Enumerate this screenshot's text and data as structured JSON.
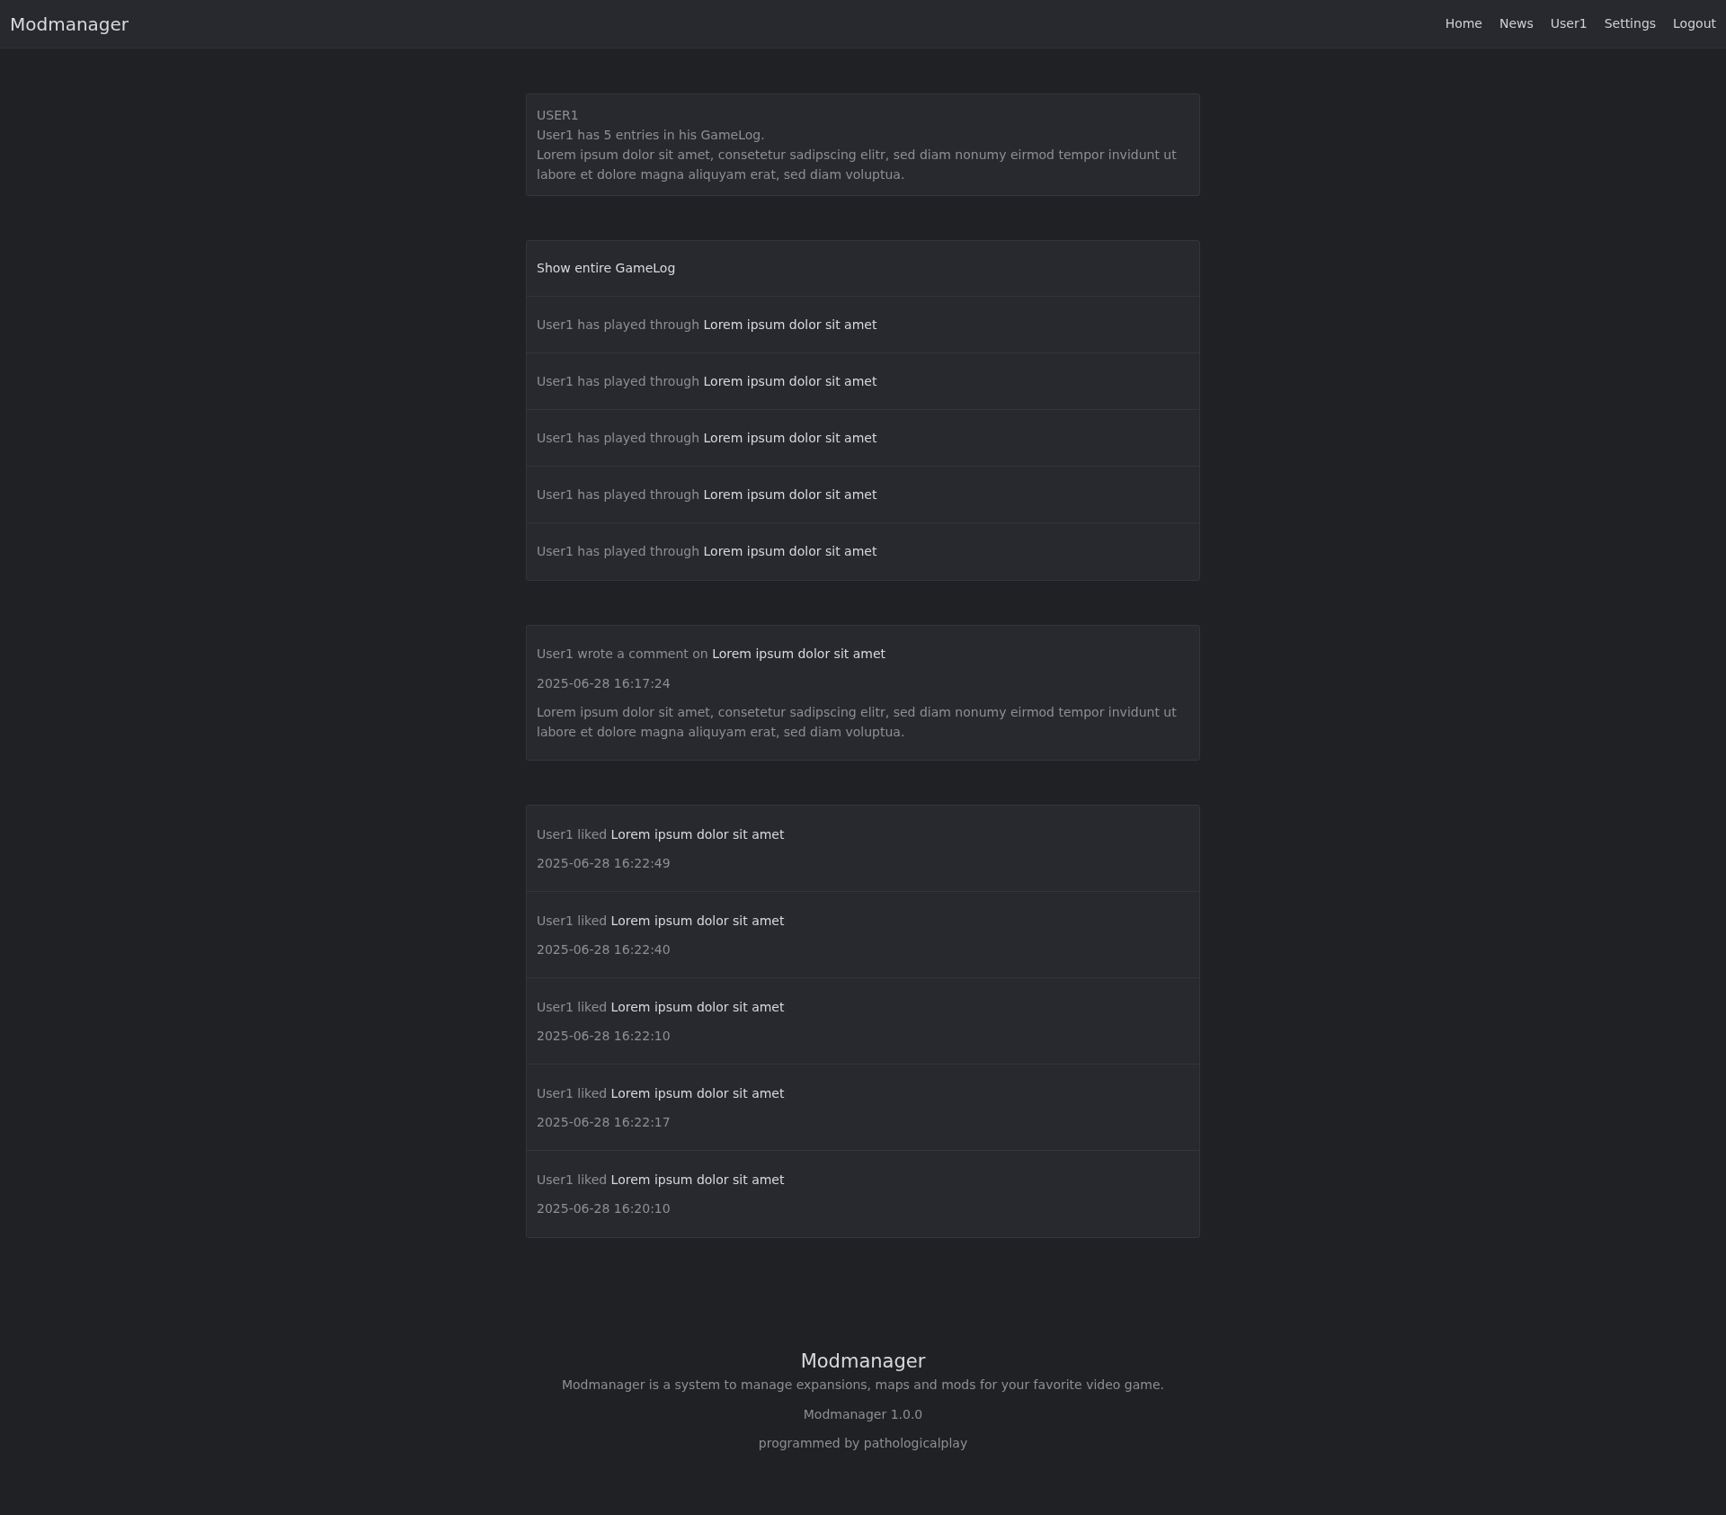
{
  "navbar": {
    "brand": "Modmanager",
    "links": [
      "Home",
      "News",
      "User1",
      "Settings",
      "Logout"
    ]
  },
  "profile": {
    "username": "USER1",
    "entries_text": "User1 has 5 entries in his GameLog.",
    "bio": "Lorem ipsum dolor sit amet, consetetur sadipscing elitr, sed diam nonumy eirmod tempor invidunt ut labore et dolore magna aliquyam erat, sed diam voluptua."
  },
  "gamelog": {
    "header_link": "Show entire GameLog",
    "entries": [
      {
        "text": "User1 has played through",
        "game": "Lorem ipsum dolor sit amet"
      },
      {
        "text": "User1 has played through",
        "game": "Lorem ipsum dolor sit amet"
      },
      {
        "text": "User1 has played through",
        "game": "Lorem ipsum dolor sit amet"
      },
      {
        "text": "User1 has played through",
        "game": "Lorem ipsum dolor sit amet"
      },
      {
        "text": "User1 has played through",
        "game": "Lorem ipsum dolor sit amet"
      }
    ]
  },
  "comment": {
    "text": "User1 wrote a comment on",
    "target": "Lorem ipsum dolor sit amet",
    "timestamp": "2025-06-28 16:17:24",
    "body": "Lorem ipsum dolor sit amet, consetetur sadipscing elitr, sed diam nonumy eirmod tempor invidunt ut labore et dolore magna aliquyam erat, sed diam voluptua."
  },
  "likes": [
    {
      "text": "User1 liked",
      "target": "Lorem ipsum dolor sit amet",
      "timestamp": "2025-06-28 16:22:49"
    },
    {
      "text": "User1 liked",
      "target": "Lorem ipsum dolor sit amet",
      "timestamp": "2025-06-28 16:22:40"
    },
    {
      "text": "User1 liked",
      "target": "Lorem ipsum dolor sit amet",
      "timestamp": "2025-06-28 16:22:10"
    },
    {
      "text": "User1 liked",
      "target": "Lorem ipsum dolor sit amet",
      "timestamp": "2025-06-28 16:22:17"
    },
    {
      "text": "User1 liked",
      "target": "Lorem ipsum dolor sit amet",
      "timestamp": "2025-06-28 16:20:10"
    }
  ],
  "footer": {
    "title": "Modmanager",
    "description": "Modmanager is a system to manage expansions, maps and mods for your favorite video game.",
    "version": "Modmanager 1.0.0",
    "credit": "programmed by pathologicalplay"
  }
}
